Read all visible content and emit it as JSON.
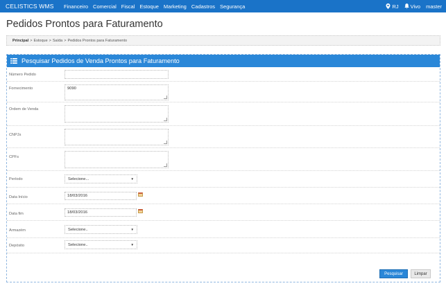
{
  "navbar": {
    "brand": "CELISTICS WMS",
    "menu": [
      "Financeiro",
      "Comercial",
      "Fiscal",
      "Estoque",
      "Marketing",
      "Cadastros",
      "Segurança"
    ],
    "location": "RJ",
    "status": "Vivo",
    "user": "master"
  },
  "page": {
    "title": "Pedidos Prontos para Faturamento"
  },
  "breadcrumb": {
    "items": [
      "Principal",
      "Estoque",
      "Saída",
      "Pedidos Prontos para Faturamento"
    ]
  },
  "panel": {
    "title": "Pesquisar Pedidos de Venda Prontos para Faturamento"
  },
  "form": {
    "numero_pedido": {
      "label": "Número Pedido",
      "value": ""
    },
    "fornecimento": {
      "label": "Fornecimento",
      "value": "9090"
    },
    "ordem_venda": {
      "label": "Ordem de Venda",
      "value": ""
    },
    "cnpjs": {
      "label": "CNPJs",
      "value": ""
    },
    "cpfs": {
      "label": "CPFs",
      "value": ""
    },
    "periodo": {
      "label": "Período",
      "value": "Selecione..."
    },
    "data_inicio": {
      "label": "Data Início",
      "value": "18/03/2016"
    },
    "data_fim": {
      "label": "Data fim",
      "value": "18/03/2016"
    },
    "armazem": {
      "label": "Armazém",
      "value": "Selecione.."
    },
    "deposito": {
      "label": "Depósito",
      "value": "Selecione.."
    }
  },
  "actions": {
    "search": "Pesquisar",
    "clear": "Limpar"
  },
  "colors": {
    "navbar": "#1a73c8",
    "panel_header": "#2a87d8",
    "primary_button": "#2a87d8"
  },
  "icons": [
    "map-marker-icon",
    "bell-icon",
    "list-icon",
    "calendar-icon",
    "caret-down-icon"
  ]
}
